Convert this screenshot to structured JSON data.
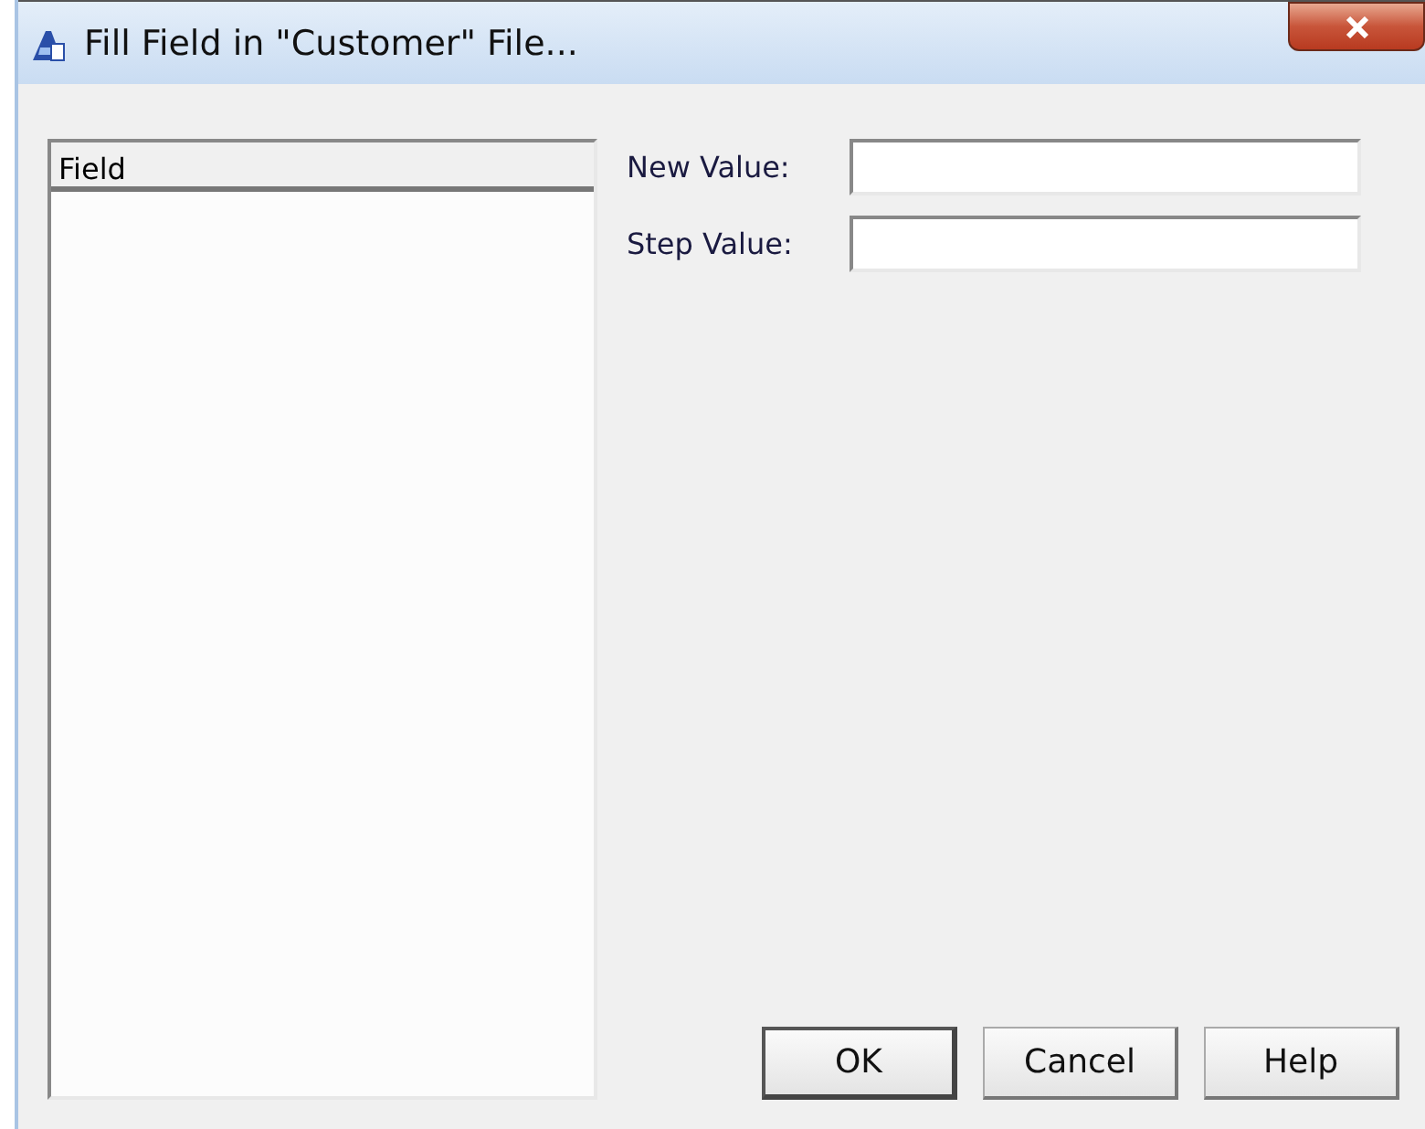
{
  "window": {
    "title": "Fill Field in \"Customer\" File..."
  },
  "field_list": {
    "header": "Field"
  },
  "fields": [
    {
      "label": "New Value:"
    },
    {
      "label": "Step Value:"
    }
  ],
  "buttons": [
    {
      "label": "OK",
      "default": true
    },
    {
      "label": "Cancel",
      "default": false
    },
    {
      "label": "Help",
      "default": false
    }
  ]
}
